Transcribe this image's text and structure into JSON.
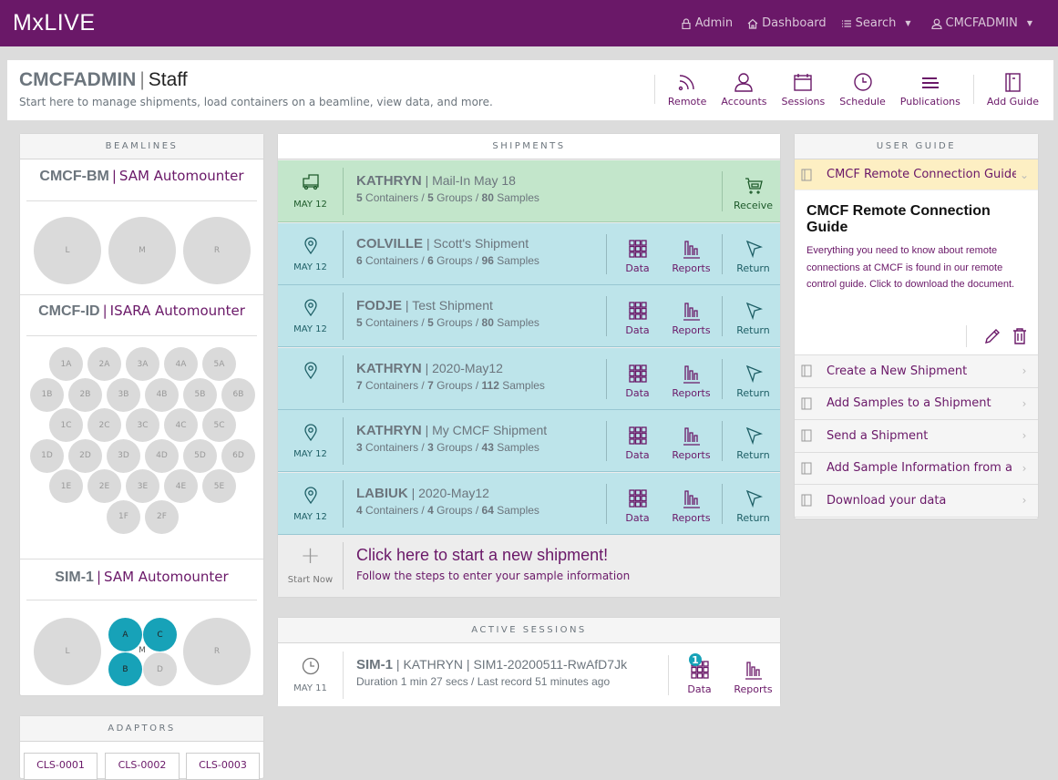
{
  "navbar": {
    "brand": "MxLIVE",
    "items": [
      {
        "label": "Admin",
        "icon": "lock-icon"
      },
      {
        "label": "Dashboard",
        "icon": "home-icon"
      },
      {
        "label": "Search",
        "icon": "list-icon",
        "dropdown": true
      },
      {
        "label": "CMCFADMIN",
        "icon": "user-icon",
        "dropdown": true
      }
    ]
  },
  "header": {
    "username": "CMCFADMIN",
    "separator": "|",
    "role": "Staff",
    "subtitle": "Start here to manage shipments, load containers on a beamline, view data, and more.",
    "toolbar": [
      {
        "label": "Remote",
        "icon": "rss-icon"
      },
      {
        "label": "Accounts",
        "icon": "user-icon"
      },
      {
        "label": "Sessions",
        "icon": "calendar-icon"
      },
      {
        "label": "Schedule",
        "icon": "clock-icon"
      },
      {
        "label": "Publications",
        "icon": "lines-icon"
      },
      {
        "label": "Add Guide",
        "icon": "notebook-icon"
      }
    ]
  },
  "beamlines": {
    "heading": "BEAMLINES",
    "items": [
      {
        "name": "CMCF-BM",
        "sep": "|",
        "device": "SAM Automounter",
        "ports": [
          "L",
          "M",
          "R"
        ]
      },
      {
        "name": "CMCF-ID",
        "sep": "|",
        "device": "ISARA Automounter",
        "ports": [
          "1A",
          "2A",
          "3A",
          "4A",
          "5A",
          "1B",
          "2B",
          "3B",
          "4B",
          "5B",
          "6B",
          "1C",
          "2C",
          "3C",
          "4C",
          "5C",
          "1D",
          "2D",
          "3D",
          "4D",
          "5D",
          "6D",
          "1E",
          "2E",
          "3E",
          "4E",
          "5E",
          "1F",
          "2F"
        ]
      },
      {
        "name": "SIM-1",
        "sep": "|",
        "device": "SAM Automounter",
        "ports": [
          "L",
          "M",
          "R",
          "A",
          "B",
          "C",
          "D"
        ],
        "active_ports": [
          "A",
          "B",
          "C"
        ]
      }
    ]
  },
  "adaptors": {
    "heading": "ADAPTORS",
    "items": [
      "CLS-0001",
      "CLS-0002",
      "CLS-0003"
    ]
  },
  "shipments": {
    "heading": "SHIPMENTS",
    "items": [
      {
        "owner": "KATHRYN",
        "name": "Mail-In May 18",
        "date": "MAY 12",
        "containers": "5",
        "groups": "5",
        "samples": "80",
        "status": "sent",
        "icon": "truck-icon",
        "actions": [
          "Receive"
        ]
      },
      {
        "owner": "COLVILLE",
        "name": "Scott's Shipment",
        "date": "MAY 12",
        "containers": "6",
        "groups": "6",
        "samples": "96",
        "status": "on-site",
        "icon": "map-pin-icon",
        "actions": [
          "Data",
          "Reports",
          "Return"
        ]
      },
      {
        "owner": "FODJE",
        "name": "Test Shipment",
        "date": "MAY 12",
        "containers": "5",
        "groups": "5",
        "samples": "80",
        "status": "on-site",
        "icon": "map-pin-icon",
        "actions": [
          "Data",
          "Reports",
          "Return"
        ]
      },
      {
        "owner": "KATHRYN",
        "name": "2020-May12",
        "date": "",
        "containers": "7",
        "groups": "7",
        "samples": "112",
        "status": "on-site",
        "icon": "map-pin-icon",
        "actions": [
          "Data",
          "Reports",
          "Return"
        ]
      },
      {
        "owner": "KATHRYN",
        "name": "My CMCF Shipment",
        "date": "MAY 12",
        "containers": "3",
        "groups": "3",
        "samples": "43",
        "status": "on-site",
        "icon": "map-pin-icon",
        "actions": [
          "Data",
          "Reports",
          "Return"
        ]
      },
      {
        "owner": "LABIUK",
        "name": "2020-May12",
        "date": "MAY 12",
        "containers": "4",
        "groups": "4",
        "samples": "64",
        "status": "on-site",
        "icon": "map-pin-icon",
        "actions": [
          "Data",
          "Reports",
          "Return"
        ]
      }
    ],
    "labels": {
      "containers": "Containers",
      "groups": "Groups",
      "samples": "Samples",
      "slash": "/",
      "sep": "|"
    },
    "new": {
      "label": "Start Now",
      "title": "Click here to start a new shipment!",
      "subtitle": "Follow the steps to enter your sample information"
    }
  },
  "sessions": {
    "heading": "ACTIVE SESSIONS",
    "items": [
      {
        "beamline": "SIM-1",
        "user": "KATHRYN",
        "name": "SIM1-20200511-RwAfD7Jk",
        "date": "MAY 11",
        "duration": "Duration 1 min 27 secs / Last record 51 minutes ago",
        "data_count": "1",
        "actions": [
          "Data",
          "Reports"
        ]
      }
    ]
  },
  "guide": {
    "heading": "USER GUIDE",
    "active": {
      "title": "CMCF Remote Connection Guide",
      "heading": "CMCF Remote Connection Guide",
      "body": "Everything you need to know about remote connections at CMCF is found in our remote control guide. Click to download the document."
    },
    "items": [
      "Create a New Shipment",
      "Add Samples to a Shipment",
      "Send a Shipment",
      "Add Sample Information from a ...",
      "Download your data"
    ]
  },
  "colors": {
    "brand": "#6a1868",
    "onsite": "#bde4ea",
    "sent": "#c3e6cb",
    "active_port": "#17a2b8",
    "guide_active": "#fdefc3"
  }
}
